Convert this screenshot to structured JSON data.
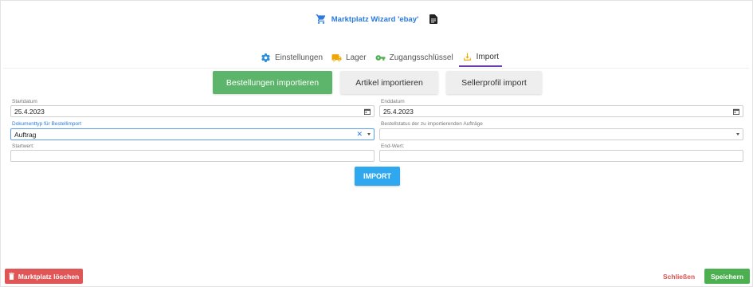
{
  "header": {
    "title": "Marktplatz Wizard 'ebay'",
    "cart_icon": "shopping-cart-icon",
    "doc_icon": "document-icon",
    "title_color": "#2a7ae2"
  },
  "tabs": [
    {
      "label": "Einstellungen",
      "icon": "gear-icon",
      "color": "#2a8fd8"
    },
    {
      "label": "Lager",
      "icon": "truck-icon",
      "color": "#f0a500"
    },
    {
      "label": "Zugangsschlüssel",
      "icon": "key-icon",
      "color": "#4caf50"
    },
    {
      "label": "Import",
      "icon": "download-icon",
      "color": "#f0a500",
      "active": true
    }
  ],
  "actions": {
    "orders_import": "Bestellungen importieren",
    "articles_import": "Artikel importieren",
    "seller_profile_import": "Sellerprofil import"
  },
  "form": {
    "start_date": {
      "label": "Startdatum",
      "value": "25.4.2023"
    },
    "end_date": {
      "label": "Enddatum",
      "value": "25.4.2023"
    },
    "doc_type": {
      "label": "Dokumenttyp für Bestellimport",
      "value": "Auftrag"
    },
    "order_status": {
      "label": "Bestellstatus der zu importierenden Aufträge",
      "value": ""
    },
    "start_value": {
      "label": "Startwert:",
      "value": ""
    },
    "end_value": {
      "label": "End-Wert:",
      "value": ""
    },
    "import_label": "IMPORT"
  },
  "footer": {
    "delete_label": "Marktplatz löschen",
    "close_label": "Schließen",
    "save_label": "Speichern"
  },
  "colors": {
    "green": "#5cb56a",
    "blue": "#2fa8f0",
    "red": "#e05555",
    "accent": "#6a3fb5"
  }
}
